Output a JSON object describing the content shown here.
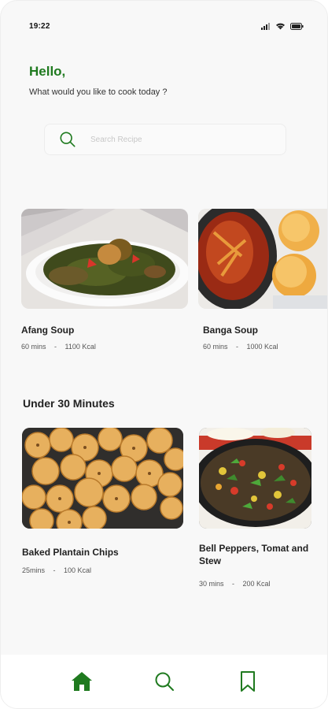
{
  "status": {
    "time": "19:22"
  },
  "header": {
    "greeting": "Hello,",
    "subtitle": "What would you like to cook today ?"
  },
  "search": {
    "placeholder": "Search Recipe"
  },
  "featured": [
    {
      "title": "Afang Soup",
      "time": "60 mins",
      "separator": "-",
      "calories": "1100 Kcal"
    },
    {
      "title": "Banga Soup",
      "time": "60 mins",
      "separator": "-",
      "calories": "1000 Kcal"
    }
  ],
  "section": {
    "title": "Under 30 Minutes"
  },
  "quick": [
    {
      "title": "Baked Plantain Chips",
      "time": "25mins",
      "separator": "-",
      "calories": "100 Kcal"
    },
    {
      "title": "Bell Peppers, Tomat and Stew",
      "time": "30 mins",
      "separator": "-",
      "calories": "200 Kcal"
    }
  ],
  "nav": {
    "items": [
      "home-icon",
      "search-icon",
      "bookmark-icon"
    ],
    "active_color": "#1f7a1f"
  },
  "colors": {
    "accent": "#1f7a1f"
  }
}
